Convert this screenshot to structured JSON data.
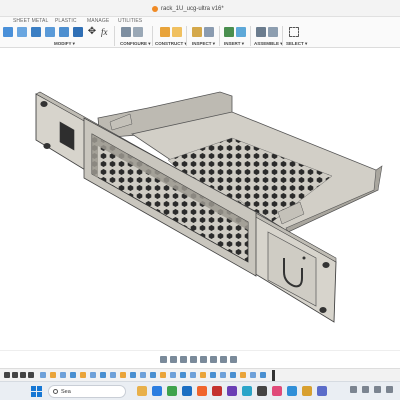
{
  "window": {
    "title": "rack_1U_ucg-ultra v16*",
    "accent_color": "#f08a24"
  },
  "ribbon": {
    "tabs": [
      "SHEET METAL",
      "PLASTIC",
      "MANAGE",
      "UTILITIES"
    ],
    "groups": [
      "MODIFY ▾",
      "CONFIGURE ▾",
      "CONSTRUCT ▾",
      "INSPECT ▾",
      "INSERT ▾",
      "ASSEMBLE ▾",
      "SELECT ▾"
    ],
    "formula_symbol": "fx"
  },
  "canvas": {
    "model": "1U rack-mount bracket with hexagonal vent pattern and front cutout",
    "model_color": "#cfccc4"
  },
  "taskbar": {
    "search_placeholder": "Sea"
  }
}
